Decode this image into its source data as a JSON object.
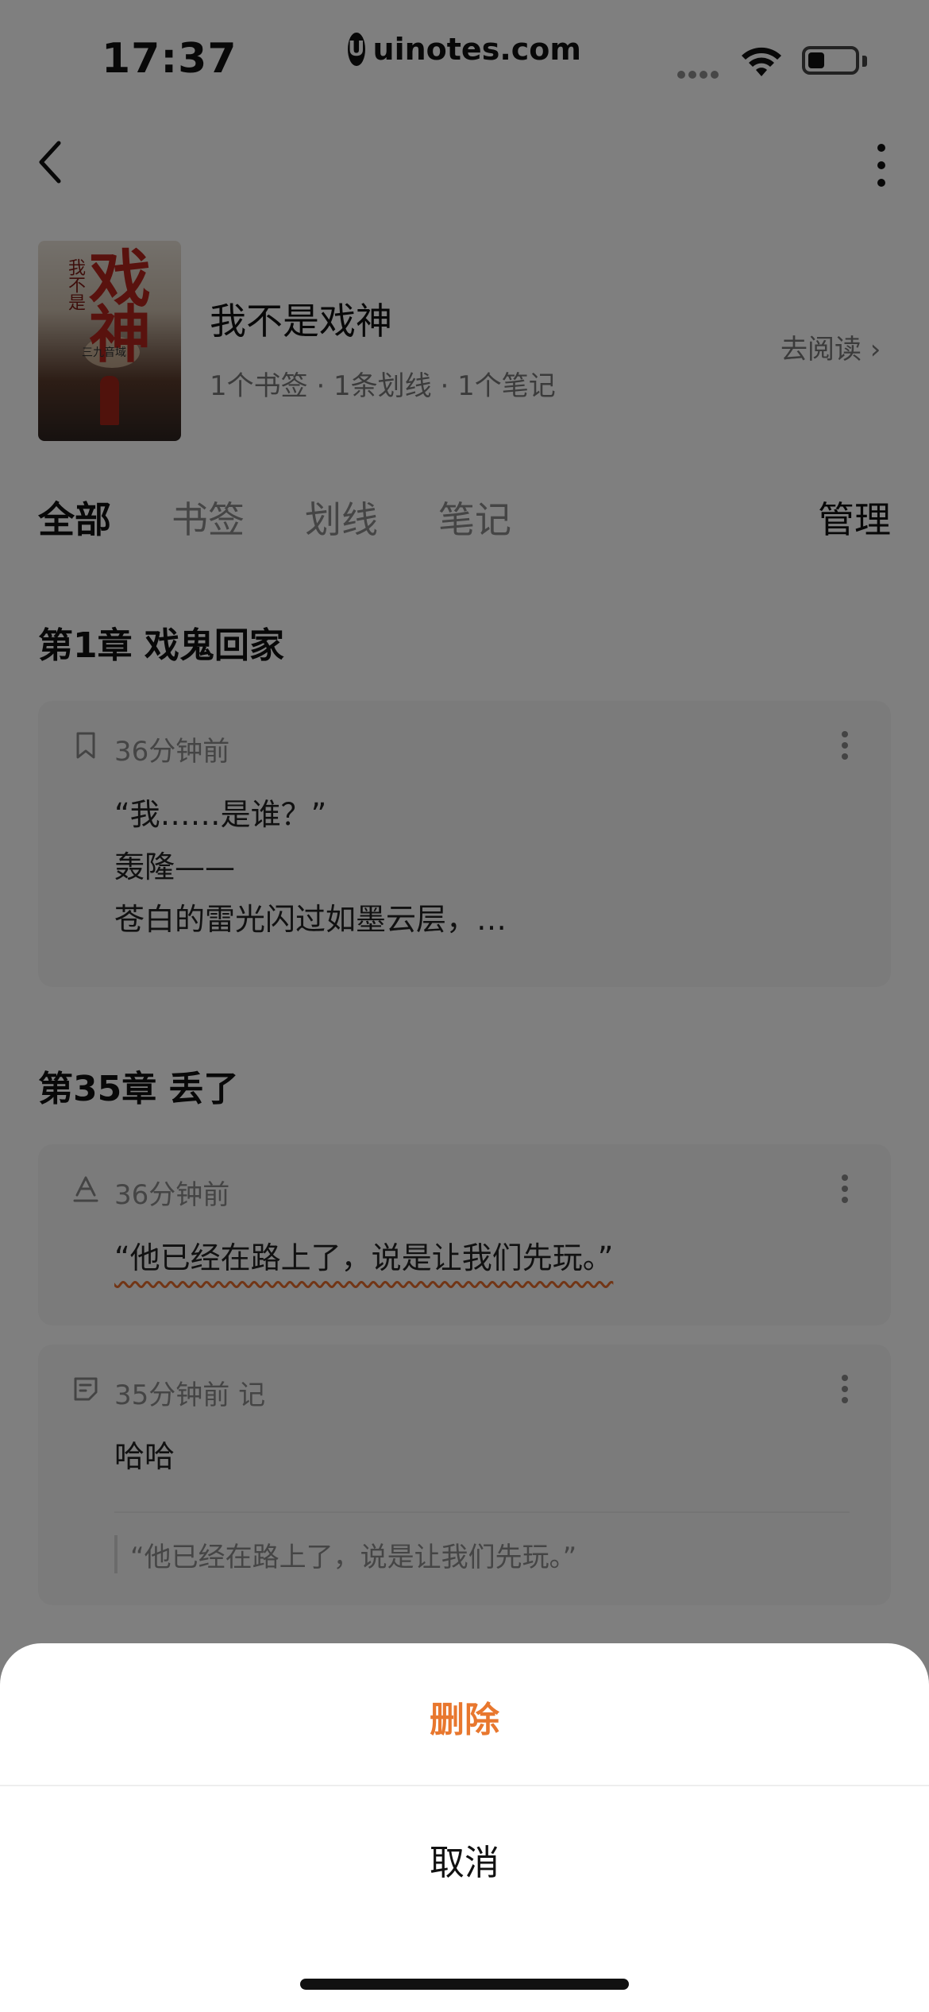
{
  "status_bar": {
    "time": "17:37",
    "url": "uinotes.com",
    "url_logo_letter": "U"
  },
  "book": {
    "title": "我不是戏神",
    "meta": "1个书签 · 1条划线 · 1个笔记",
    "go_read": "去阅读 ›",
    "cover_title": "戏神",
    "cover_sub": "我不是",
    "cover_author": "三九音域"
  },
  "tabs": [
    "全部",
    "书签",
    "划线",
    "笔记"
  ],
  "manage_label": "管理",
  "chapters": [
    {
      "title": "第1章 戏鬼回家",
      "cards": [
        {
          "icon": "bookmark-icon",
          "time": "36分钟前",
          "lines": [
            "“我……是谁？”",
            "轰隆——",
            "苍白的雷光闪过如墨云层，…"
          ]
        }
      ]
    },
    {
      "title": "第35章 丢了",
      "cards": [
        {
          "icon": "highlight-icon",
          "time": "36分钟前",
          "lines": [
            "“他已经在路上了，说是让我们先玩。”"
          ]
        },
        {
          "icon": "note-icon",
          "time": "35分钟前 记",
          "lines": [
            "哈哈"
          ],
          "quote": "“他已经在路上了，说是让我们先玩。”"
        }
      ]
    }
  ],
  "sheet": {
    "delete_label": "删除",
    "cancel_label": "取消"
  },
  "colors": {
    "accent": "#e8772e",
    "overlay": "rgba(0,0,0,0.5)"
  }
}
